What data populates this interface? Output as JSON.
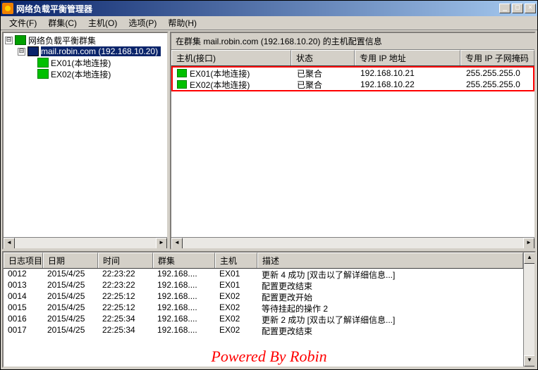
{
  "window": {
    "title": "网络负载平衡管理器",
    "btn_min": "_",
    "btn_max": "□",
    "btn_close": "✕"
  },
  "menu": {
    "file": "文件(F)",
    "cluster": "群集(C)",
    "host": "主机(O)",
    "options": "选项(P)",
    "help": "帮助(H)"
  },
  "tree": {
    "expand_minus": "⊟",
    "root": "网络负载平衡群集",
    "cluster": "mail.robin.com (192.168.10.20)",
    "node1": "EX01(本地连接)",
    "node2": "EX02(本地连接)"
  },
  "detail": {
    "header": "在群集 mail.robin.com (192.168.10.20) 的主机配置信息",
    "cols": {
      "host": "主机(接口)",
      "status": "状态",
      "ip": "专用 IP 地址",
      "mask": "专用 IP 子网掩码"
    },
    "rows": [
      {
        "host": "EX01(本地连接)",
        "status": "已聚合",
        "ip": "192.168.10.21",
        "mask": "255.255.255.0"
      },
      {
        "host": "EX02(本地连接)",
        "status": "已聚合",
        "ip": "192.168.10.22",
        "mask": "255.255.255.0"
      }
    ]
  },
  "log": {
    "cols": {
      "idx": "日志项目",
      "date": "日期",
      "time": "时间",
      "cluster": "群集",
      "host": "主机",
      "desc": "描述"
    },
    "rows": [
      {
        "idx": "0012",
        "date": "2015/4/25",
        "time": "22:23:22",
        "cluster": "192.168....",
        "host": "EX01",
        "desc": "更新 4 成功 [双击以了解详细信息...]"
      },
      {
        "idx": "0013",
        "date": "2015/4/25",
        "time": "22:23:22",
        "cluster": "192.168....",
        "host": "EX01",
        "desc": "配置更改结束"
      },
      {
        "idx": "0014",
        "date": "2015/4/25",
        "time": "22:25:12",
        "cluster": "192.168....",
        "host": "EX02",
        "desc": "配置更改开始"
      },
      {
        "idx": "0015",
        "date": "2015/4/25",
        "time": "22:25:12",
        "cluster": "192.168....",
        "host": "EX02",
        "desc": "等待挂起的操作 2"
      },
      {
        "idx": "0016",
        "date": "2015/4/25",
        "time": "22:25:34",
        "cluster": "192.168....",
        "host": "EX02",
        "desc": "更新 2 成功 [双击以了解详细信息...]"
      },
      {
        "idx": "0017",
        "date": "2015/4/25",
        "time": "22:25:34",
        "cluster": "192.168....",
        "host": "EX02",
        "desc": "配置更改结束"
      }
    ]
  },
  "scroll": {
    "left": "◄",
    "right": "►",
    "up": "▲",
    "down": "▼"
  },
  "watermark": "Powered By Robin"
}
